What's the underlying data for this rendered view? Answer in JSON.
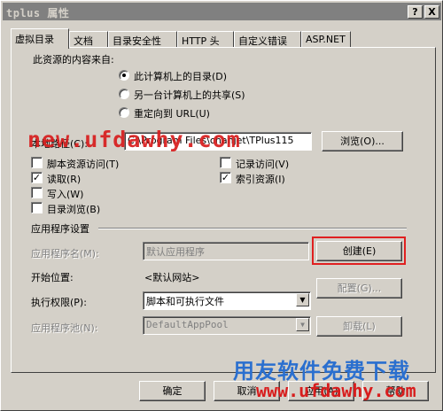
{
  "window": {
    "title": "tplus 属性",
    "help_btn": "?",
    "close_btn": "X"
  },
  "tabs": [
    "虚拟目录",
    "文档",
    "目录安全性",
    "HTTP 头",
    "自定义错误",
    "ASP.NET"
  ],
  "source": {
    "heading": "此资源的内容来自:",
    "options": [
      {
        "label": "此计算机上的目录(D)",
        "selected": true
      },
      {
        "label": "另一台计算机上的共享(S)",
        "selected": false
      },
      {
        "label": "重定向到 URL(U)",
        "selected": false
      }
    ]
  },
  "local_path": {
    "label": "本地路径(C):",
    "value": "C:\\Program Files\\chanjet\\TPlus115",
    "browse": "浏览(O)..."
  },
  "checkboxes": {
    "left": [
      {
        "label": "脚本资源访问(T)",
        "checked": false
      },
      {
        "label": "读取(R)",
        "checked": true
      },
      {
        "label": "写入(W)",
        "checked": false
      },
      {
        "label": "目录浏览(B)",
        "checked": false
      }
    ],
    "right": [
      {
        "label": "记录访问(V)",
        "checked": false
      },
      {
        "label": "索引资源(I)",
        "checked": true
      }
    ]
  },
  "app": {
    "section_title": "应用程序设置",
    "name_label": "应用程序名(M):",
    "name_value": "默认应用程序",
    "create": "创建(E)",
    "start_label": "开始位置:",
    "start_value": "<默认网站>",
    "config": "配置(G)...",
    "perm_label": "执行权限(P):",
    "perm_value": "脚本和可执行文件",
    "pool_label": "应用程序池(N):",
    "pool_value": "DefaultAppPool",
    "unload": "卸载(L)"
  },
  "buttons": {
    "ok": "确定",
    "cancel": "取消",
    "apply": "应用(A)",
    "help": "帮助"
  },
  "watermark": {
    "url": "new.ufdawhy.com",
    "brand": "用友软件免费下载",
    "brand_url": "www.ufdawhy.com"
  },
  "colors": {
    "face": "#d4d0c8",
    "highlight_box": "#e02020",
    "watermark_red": "#d81d1d",
    "watermark_blue": "#2a6fcf"
  }
}
